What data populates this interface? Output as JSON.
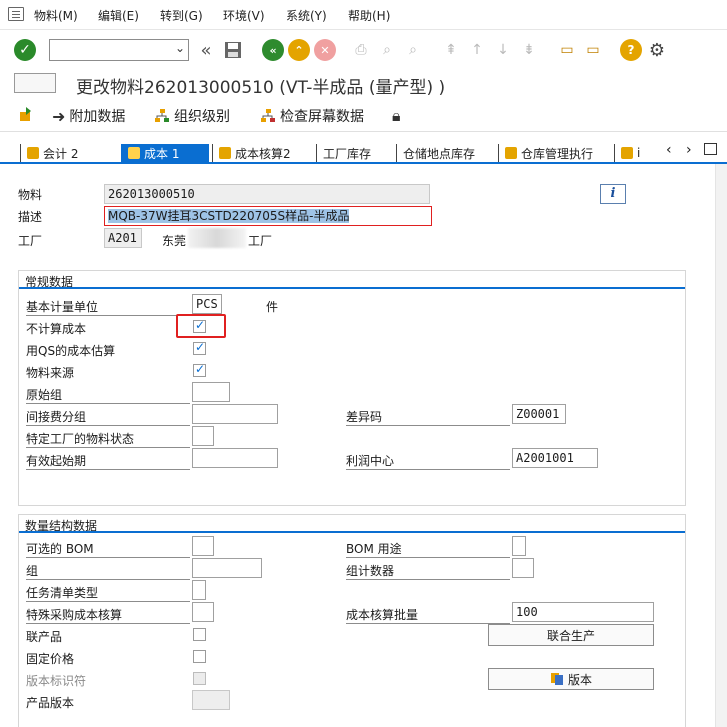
{
  "menubar": {
    "items": [
      "物料(M)",
      "编辑(E)",
      "转到(G)",
      "环境(V)",
      "系统(Y)",
      "帮助(H)"
    ]
  },
  "toolbar": {
    "command_field_value": ""
  },
  "title": {
    "text": "更改物料262013000510 (VT-半成品 (量产型) )"
  },
  "app_toolbar": {
    "additional_data": "附加数据",
    "org_levels": "组织级别",
    "check_screen_data": "检查屏幕数据"
  },
  "tabs": [
    {
      "label": "会计 2",
      "active": false
    },
    {
      "label": "成本 1",
      "active": true
    },
    {
      "label": "成本核算2",
      "active": false
    },
    {
      "label": "工厂库存",
      "active": false
    },
    {
      "label": "仓储地点库存",
      "active": false
    },
    {
      "label": "仓库管理执行",
      "active": false
    },
    {
      "label": "i",
      "active": false
    }
  ],
  "header": {
    "material_label": "物料",
    "material_value": "262013000510",
    "description_label": "描述",
    "description_value": "MQB-37W挂耳3CSTD220705S样品-半成品",
    "plant_label": "工厂",
    "plant_value": "A201",
    "plant_name_prefix": "东莞",
    "plant_name_suffix": "工厂"
  },
  "general_data": {
    "title": "常规数据",
    "base_uom_label": "基本计量单位",
    "base_uom_value": "PCS",
    "base_uom_text": "件",
    "no_costing_label": "不计算成本",
    "no_costing_checked": true,
    "qs_costing_label": "用QS的成本估算",
    "qs_costing_checked": true,
    "material_origin_label": "物料来源",
    "material_origin_checked": true,
    "origin_group_label": "原始组",
    "origin_group_value": "",
    "overhead_group_label": "间接费分组",
    "overhead_group_value": "",
    "variance_key_label": "差异码",
    "variance_key_value": "Z00001",
    "plant_status_label": "特定工厂的物料状态",
    "plant_status_value": "",
    "valid_from_label": "有效起始期",
    "valid_from_value": "",
    "profit_center_label": "利润中心",
    "profit_center_value": "A2001001"
  },
  "quantity_structure": {
    "title": "数量结构数据",
    "alt_bom_label": "可选的 BOM",
    "alt_bom_value": "",
    "bom_usage_label": "BOM 用途",
    "bom_usage_value": "",
    "group_label": "组",
    "group_value": "",
    "group_counter_label": "组计数器",
    "group_counter_value": "",
    "task_list_type_label": "任务清单类型",
    "task_list_type_value": "",
    "special_proc_label": "特殊采购成本核算",
    "special_proc_value": "",
    "costing_lot_size_label": "成本核算批量",
    "costing_lot_size_value": "100",
    "co_product_label": "联产品",
    "co_product_checked": false,
    "joint_production_button": "联合生产",
    "fixed_price_label": "固定价格",
    "fixed_price_checked": false,
    "version_indicator_label": "版本标识符",
    "version_indicator_checked": false,
    "version_button": "版本",
    "product_version_label": "产品版本",
    "product_version_value": ""
  },
  "colors": {
    "accent": "#0a6ed1",
    "highlight_box": "#e02020",
    "selected_text_bg": "#9ec3e6"
  }
}
